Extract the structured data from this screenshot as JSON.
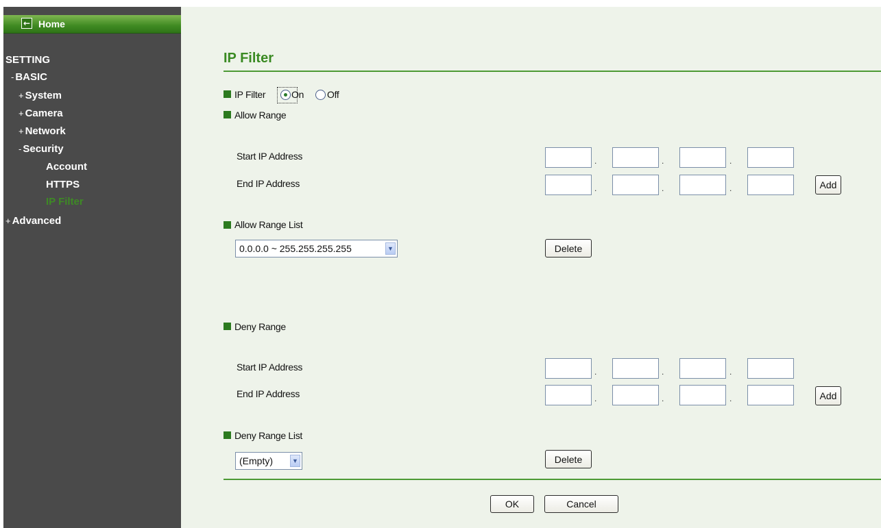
{
  "sidebar": {
    "home_label": "Home",
    "setting_label": "SETTING",
    "basic": {
      "marker": "-",
      "label": "BASIC"
    },
    "system": {
      "marker": "+",
      "label": "System"
    },
    "camera": {
      "marker": "+",
      "label": "Camera"
    },
    "network": {
      "marker": "+",
      "label": "Network"
    },
    "security": {
      "marker": "-",
      "label": "Security"
    },
    "account": {
      "label": "Account"
    },
    "https": {
      "label": "HTTPS"
    },
    "ipfilter": {
      "label": "IP Filter"
    },
    "advanced": {
      "marker": "+",
      "label": "Advanced"
    }
  },
  "main": {
    "title": "IP Filter",
    "ip_filter": {
      "label": "IP Filter",
      "on_label": "On",
      "off_label": "Off",
      "selected": "On"
    },
    "allow": {
      "section_label": "Allow Range",
      "start_label": "Start IP Address",
      "end_label": "End IP Address",
      "start_octets": [
        "",
        "",
        "",
        ""
      ],
      "end_octets": [
        "",
        "",
        "",
        ""
      ],
      "add_label": "Add",
      "list_label": "Allow Range List",
      "list_selected": "0.0.0.0 ~ 255.255.255.255",
      "delete_label": "Delete"
    },
    "deny": {
      "section_label": "Deny Range",
      "start_label": "Start IP Address",
      "end_label": "End IP Address",
      "start_octets": [
        "",
        "",
        "",
        ""
      ],
      "end_octets": [
        "",
        "",
        "",
        ""
      ],
      "add_label": "Add",
      "list_label": "Deny Range List",
      "list_selected": "(Empty)",
      "delete_label": "Delete"
    },
    "ok_label": "OK",
    "cancel_label": "Cancel",
    "octet_separator": "."
  },
  "colors": {
    "accent_green": "#3a8a23",
    "sidebar_bg": "#4a4a4a",
    "content_bg": "#eef3ea"
  }
}
